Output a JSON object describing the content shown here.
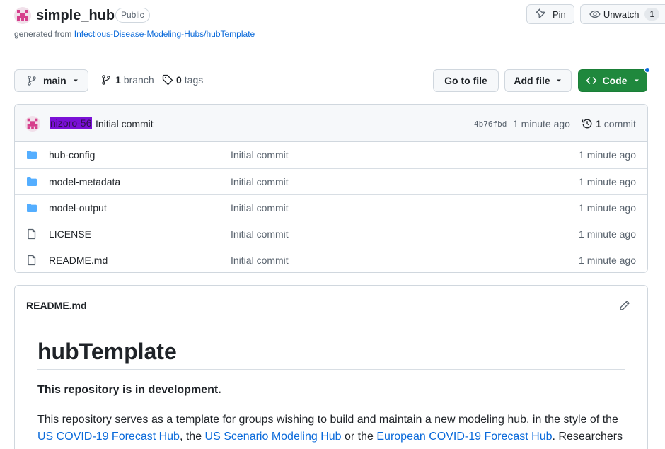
{
  "repo": {
    "name": "simple_hub",
    "visibility": "Public",
    "generated_from_prefix": "generated from",
    "template_link": "Infectious-Disease-Modeling-Hubs/hubTemplate"
  },
  "actions": {
    "pin_label": "Pin",
    "unwatch_label": "Unwatch",
    "unwatch_count": "1"
  },
  "branch_bar": {
    "current_branch": "main",
    "branch_count": "1",
    "branch_label": "branch",
    "tag_count": "0",
    "tag_label": "tags",
    "go_to_file": "Go to file",
    "add_file": "Add file",
    "code": "Code"
  },
  "latest_commit": {
    "author": "nizoro-56",
    "message": "Initial commit",
    "sha": "4b76fbd",
    "time": "1 minute ago",
    "commit_count": "1",
    "commit_label": "commit"
  },
  "files": [
    {
      "name": "hub-config",
      "type": "folder",
      "message": "Initial commit",
      "time": "1 minute ago"
    },
    {
      "name": "model-metadata",
      "type": "folder",
      "message": "Initial commit",
      "time": "1 minute ago"
    },
    {
      "name": "model-output",
      "type": "folder",
      "message": "Initial commit",
      "time": "1 minute ago"
    },
    {
      "name": "LICENSE",
      "type": "file",
      "message": "Initial commit",
      "time": "1 minute ago"
    },
    {
      "name": "README.md",
      "type": "file",
      "message": "Initial commit",
      "time": "1 minute ago"
    }
  ],
  "readme": {
    "filename": "README.md",
    "heading": "hubTemplate",
    "status": "This repository is in development.",
    "para_1": "This repository serves as a template for groups wishing to build and maintain a new modeling hub, in the style of the",
    "link_1": "US COVID-19 Forecast Hub",
    "sep_1": ", the",
    "link_2": "US Scenario Modeling Hub",
    "sep_2": "or the",
    "link_3": "European COVID-19 Forecast Hub",
    "para_2": ". Researchers"
  },
  "colors": {
    "accent_blue": "#0969da",
    "code_green": "#1f883d",
    "folder_blue": "#54aeff",
    "avatar_pink": "#d63f8c",
    "author_highlight": "#7a10d6"
  },
  "icons": {
    "pin": "pin-icon",
    "eye": "eye-icon",
    "branch": "git-branch-icon",
    "tag": "tag-icon",
    "code": "code-icon",
    "history": "history-icon",
    "folder": "folder-icon",
    "file": "file-icon",
    "edit": "pencil-icon"
  }
}
